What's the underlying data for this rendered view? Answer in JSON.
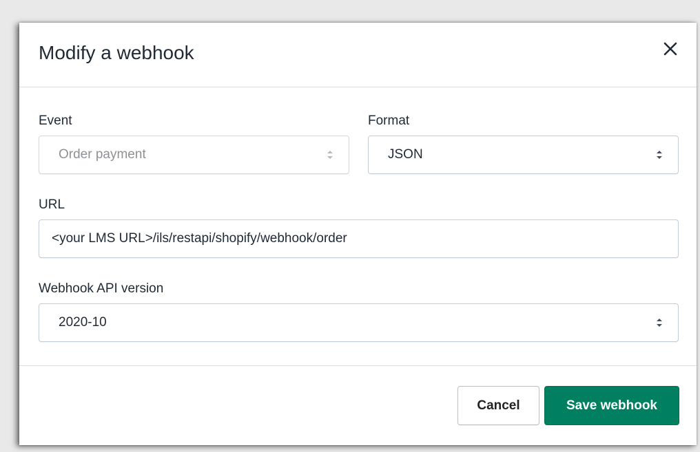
{
  "modal": {
    "title": "Modify a webhook",
    "close_icon": "close-icon"
  },
  "form": {
    "event": {
      "label": "Event",
      "value": "Order payment",
      "disabled": true
    },
    "format": {
      "label": "Format",
      "value": "JSON"
    },
    "url": {
      "label": "URL",
      "value": "<your LMS URL>/ils/restapi/shopify/webhook/order"
    },
    "api_version": {
      "label": "Webhook API version",
      "value": "2020-10"
    }
  },
  "footer": {
    "cancel_label": "Cancel",
    "save_label": "Save webhook"
  },
  "colors": {
    "primary": "#008060",
    "text": "#212b36",
    "border": "#c4cdd5",
    "disabled_text": "#8c9196"
  }
}
